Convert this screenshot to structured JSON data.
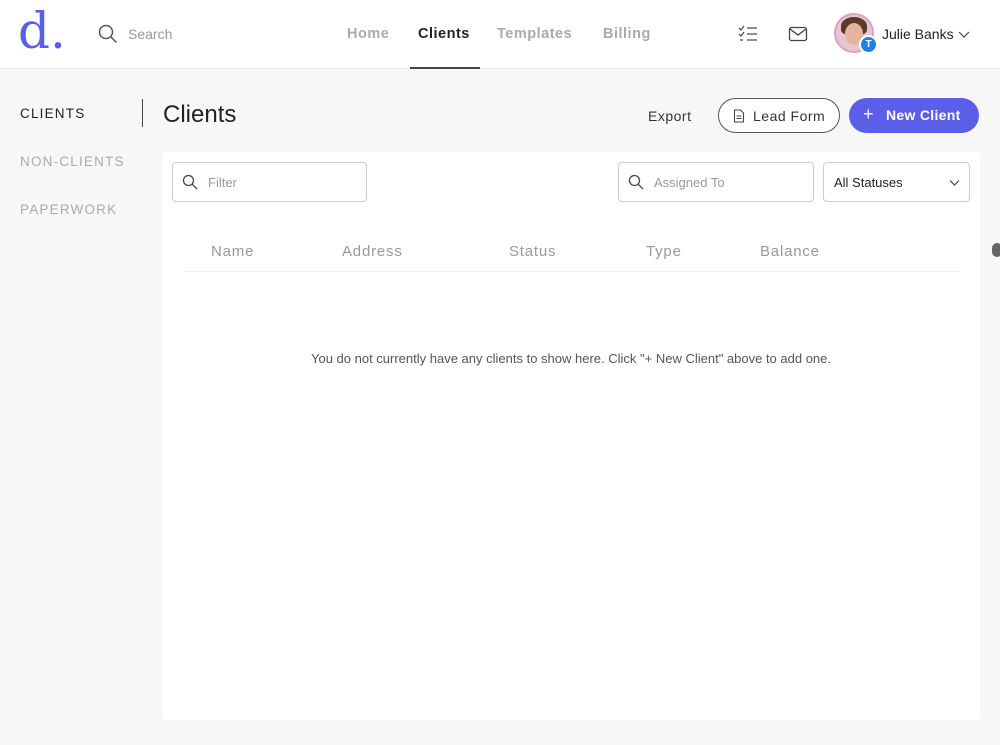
{
  "header": {
    "logo": "d.",
    "search_placeholder": "Search",
    "nav": {
      "home": "Home",
      "clients": "Clients",
      "templates": "Templates",
      "billing": "Billing"
    },
    "user": {
      "name": "Julie Banks",
      "badge": "T"
    }
  },
  "sidebar": {
    "items": [
      "CLIENTS",
      "NON-CLIENTS",
      "PAPERWORK"
    ]
  },
  "page": {
    "title": "Clients",
    "export_label": "Export",
    "lead_form_label": "Lead Form",
    "new_client_label": "New Client",
    "new_client_icon": "+"
  },
  "filters": {
    "filter_placeholder": "Filter",
    "assigned_placeholder": "Assigned To",
    "status_value": "All Statuses"
  },
  "table": {
    "columns": [
      "Name",
      "Address",
      "Status",
      "Type",
      "Balance"
    ],
    "empty_message": "You do not currently have any clients to show here. Click \"+ New Client\" above to add one."
  },
  "colors": {
    "accent": "#5b5ee8",
    "badge": "#1f7fe6"
  }
}
